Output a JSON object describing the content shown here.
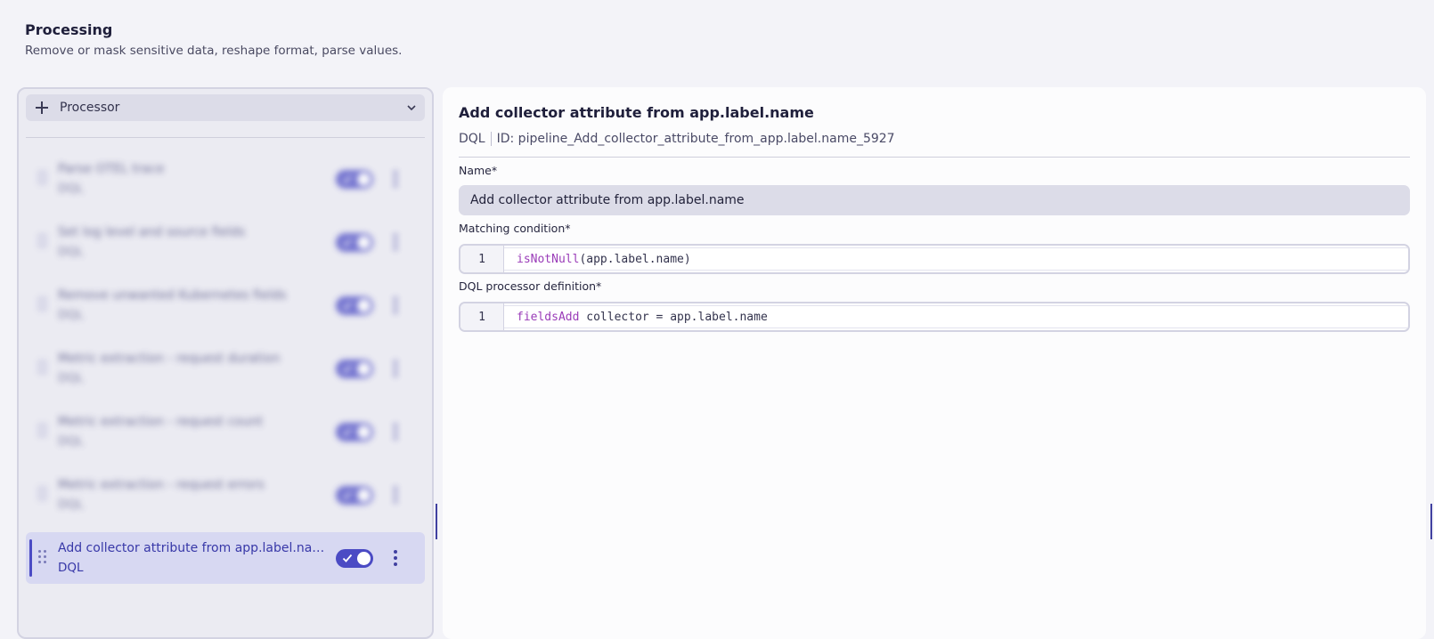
{
  "header": {
    "title": "Processing",
    "subtitle": "Remove or mask sensitive data, reshape format, parse values."
  },
  "sidebar": {
    "add_label": "Processor",
    "items": [
      {
        "name": "Parse OTEL trace",
        "type": "DQL",
        "enabled": true,
        "blurred": true
      },
      {
        "name": "Set log level and source fields",
        "type": "DQL",
        "enabled": true,
        "blurred": true
      },
      {
        "name": "Remove unwanted Kubernetes fields",
        "type": "DQL",
        "enabled": true,
        "blurred": true
      },
      {
        "name": "Metric extraction - request duration",
        "type": "DQL",
        "enabled": true,
        "blurred": true
      },
      {
        "name": "Metric extraction - request count",
        "type": "DQL",
        "enabled": true,
        "blurred": true
      },
      {
        "name": "Metric extraction - request errors",
        "type": "DQL",
        "enabled": true,
        "blurred": true
      },
      {
        "name": "Add collector attribute from app.label.name",
        "type": "DQL",
        "enabled": true,
        "blurred": false
      }
    ]
  },
  "detail": {
    "title": "Add collector attribute from app.label.name",
    "type": "DQL",
    "id_text": "ID: pipeline_Add_collector_attribute_from_app.label.name_5927",
    "name_label": "Name*",
    "name_value": "Add collector attribute from app.label.name",
    "matching_label": "Matching condition*",
    "matching_line_no": "1",
    "matching_fn": "isNotNull",
    "matching_rest": "(app.label.name)",
    "dql_label": "DQL processor definition*",
    "dql_line_no": "1",
    "dql_kw": "fieldsAdd",
    "dql_rest": " collector = app.label.name"
  },
  "colors": {
    "accent": "#4b4bc4",
    "keyword": "#9a3cb8"
  }
}
